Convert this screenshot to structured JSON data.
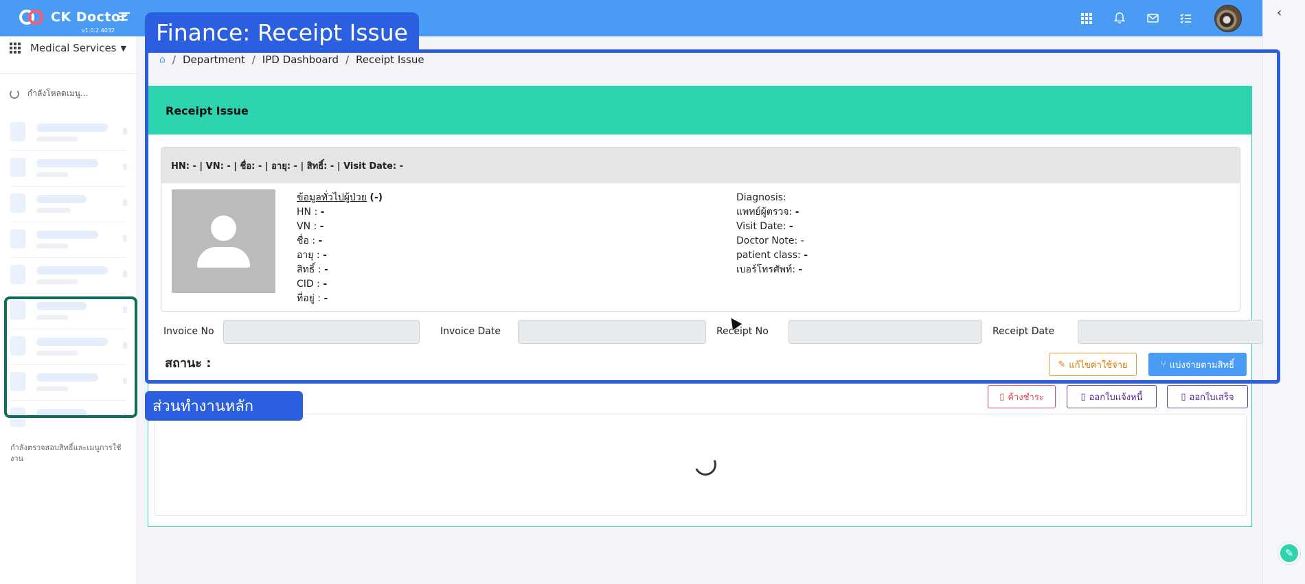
{
  "app": {
    "name": "CK Doctor",
    "version": "v1.0.2.4032"
  },
  "sidebar": {
    "module": "Medical Services",
    "loading_menu": "กำลังโหลดเมนู...",
    "status_text": "กำลังตรวจสอบสิทธิ์และเมนูการใช้งาน"
  },
  "annotations": {
    "page_title_tag": "Finance: Receipt Issue",
    "work_area_tag": "ส่วนทำงานหลัก"
  },
  "breadcrumb": {
    "items": [
      "Department",
      "IPD Dashboard",
      "Receipt Issue"
    ]
  },
  "card": {
    "title": "Receipt Issue"
  },
  "patient": {
    "header": "HN: - | VN: - | ชื่อ: - | อายุ: - | สิทธิ์: - | Visit Date: -",
    "general_info_label": "ข้อมูลทั่วไปผู้ป่วย",
    "general_info_value": "(-)",
    "left": [
      {
        "label": "HN : ",
        "value": "-"
      },
      {
        "label": "VN : ",
        "value": "-"
      },
      {
        "label": "ชื่อ : ",
        "value": "-"
      },
      {
        "label": "อายุ : ",
        "value": "-"
      },
      {
        "label": "สิทธิ์ : ",
        "value": "-"
      },
      {
        "label": "CID : ",
        "value": "-"
      },
      {
        "label": "ที่อยู่ : ",
        "value": "-"
      }
    ],
    "right": [
      {
        "label": "Diagnosis:",
        "value": ""
      },
      {
        "label": "แพทย์ผู้ตรวจ: ",
        "value": "-"
      },
      {
        "label": "Visit Date: ",
        "value": "-"
      },
      {
        "label": "Doctor Note: ",
        "value": "-"
      },
      {
        "label": "patient class: ",
        "value": "-"
      },
      {
        "label": "เบอร์โทรศัพท์: ",
        "value": "-"
      }
    ]
  },
  "fields": {
    "invoice_no_label": "Invoice No",
    "invoice_no_value": "",
    "invoice_date_label": "Invoice Date",
    "invoice_date_value": "",
    "receipt_no_label": "Receipt No",
    "receipt_no_value": "",
    "receipt_date_label": "Receipt Date",
    "receipt_date_value": ""
  },
  "status": {
    "label": "สถานะ :"
  },
  "buttons": {
    "edit_expense": "แก้ไขค่าใช้จ่าย",
    "split_by_right": "แบ่งจ่ายตามสิทธิ์",
    "pending_payment": "ค้างชำระ",
    "issue_invoice": "ออกใบแจ้งหนี้",
    "issue_receipt": "ออกใบเสร็จ"
  },
  "icons": {
    "apps": "apps-grid-icon",
    "notifications": "bell-icon",
    "mail": "mail-icon",
    "tasks": "checklist-icon"
  },
  "colors": {
    "topbar": "#4a9bf3",
    "card_header": "#2ed3b0",
    "annotation_blue": "#2b5fe0",
    "annotation_green": "#0e6e5a"
  }
}
